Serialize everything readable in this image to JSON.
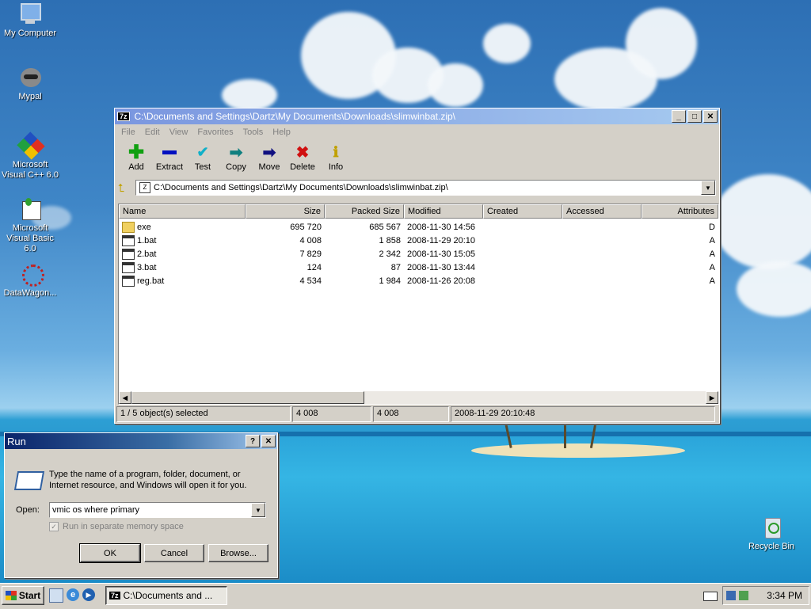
{
  "desktop": {
    "icons": [
      {
        "label": "My Computer"
      },
      {
        "label": "Mypal"
      },
      {
        "label": "Microsoft Visual C++ 6.0"
      },
      {
        "label": "Microsoft Visual Basic 6.0"
      },
      {
        "label": "DataWagon..."
      },
      {
        "label": "Recycle Bin"
      }
    ]
  },
  "zip_window": {
    "title": "C:\\Documents and Settings\\Dartz\\My Documents\\Downloads\\slimwinbat.zip\\",
    "app_icon_text": "7z",
    "menu": [
      "File",
      "Edit",
      "View",
      "Favorites",
      "Tools",
      "Help"
    ],
    "toolbar": [
      {
        "label": "Add",
        "icon": "plus-icon",
        "color": "#00a000"
      },
      {
        "label": "Extract",
        "icon": "minus-icon",
        "color": "#0000c0"
      },
      {
        "label": "Test",
        "icon": "check-icon",
        "color": "#00b0c0"
      },
      {
        "label": "Copy",
        "icon": "copy-arrow-icon",
        "color": "#008080"
      },
      {
        "label": "Move",
        "icon": "move-arrow-icon",
        "color": "#000080"
      },
      {
        "label": "Delete",
        "icon": "x-icon",
        "color": "#d00000"
      },
      {
        "label": "Info",
        "icon": "info-icon",
        "color": "#c0a000"
      }
    ],
    "address": "C:\\Documents and Settings\\Dartz\\My Documents\\Downloads\\slimwinbat.zip\\",
    "columns": [
      "Name",
      "Size",
      "Packed Size",
      "Modified",
      "Created",
      "Accessed",
      "Attributes"
    ],
    "rows": [
      {
        "name": "exe",
        "size": "695 720",
        "packed": "685 567",
        "modified": "2008-11-30 14:56",
        "created": "",
        "accessed": "",
        "attributes": "D",
        "type": "folder"
      },
      {
        "name": "1.bat",
        "size": "4 008",
        "packed": "1 858",
        "modified": "2008-11-29 20:10",
        "created": "",
        "accessed": "",
        "attributes": "A",
        "type": "file"
      },
      {
        "name": "2.bat",
        "size": "7 829",
        "packed": "2 342",
        "modified": "2008-11-30 15:05",
        "created": "",
        "accessed": "",
        "attributes": "A",
        "type": "file"
      },
      {
        "name": "3.bat",
        "size": "124",
        "packed": "87",
        "modified": "2008-11-30 13:44",
        "created": "",
        "accessed": "",
        "attributes": "A",
        "type": "file"
      },
      {
        "name": "reg.bat",
        "size": "4 534",
        "packed": "1 984",
        "modified": "2008-11-26 20:08",
        "created": "",
        "accessed": "",
        "attributes": "A",
        "type": "file"
      }
    ],
    "status": {
      "selected": "1 / 5 object(s) selected",
      "size": "4 008",
      "packed": "4 008",
      "modified": "2008-11-29 20:10:48"
    }
  },
  "run_dialog": {
    "title": "Run",
    "help_btn": "?",
    "close_btn": "✕",
    "description": "Type the name of a program, folder, document, or Internet resource, and Windows will open it for you.",
    "open_label": "Open:",
    "open_value": "vmic os where primary",
    "checkbox_label": "Run in separate memory space",
    "ok": "OK",
    "cancel": "Cancel",
    "browse": "Browse..."
  },
  "taskbar": {
    "start": "Start",
    "task": "C:\\Documents and ...",
    "clock": "3:34 PM"
  }
}
